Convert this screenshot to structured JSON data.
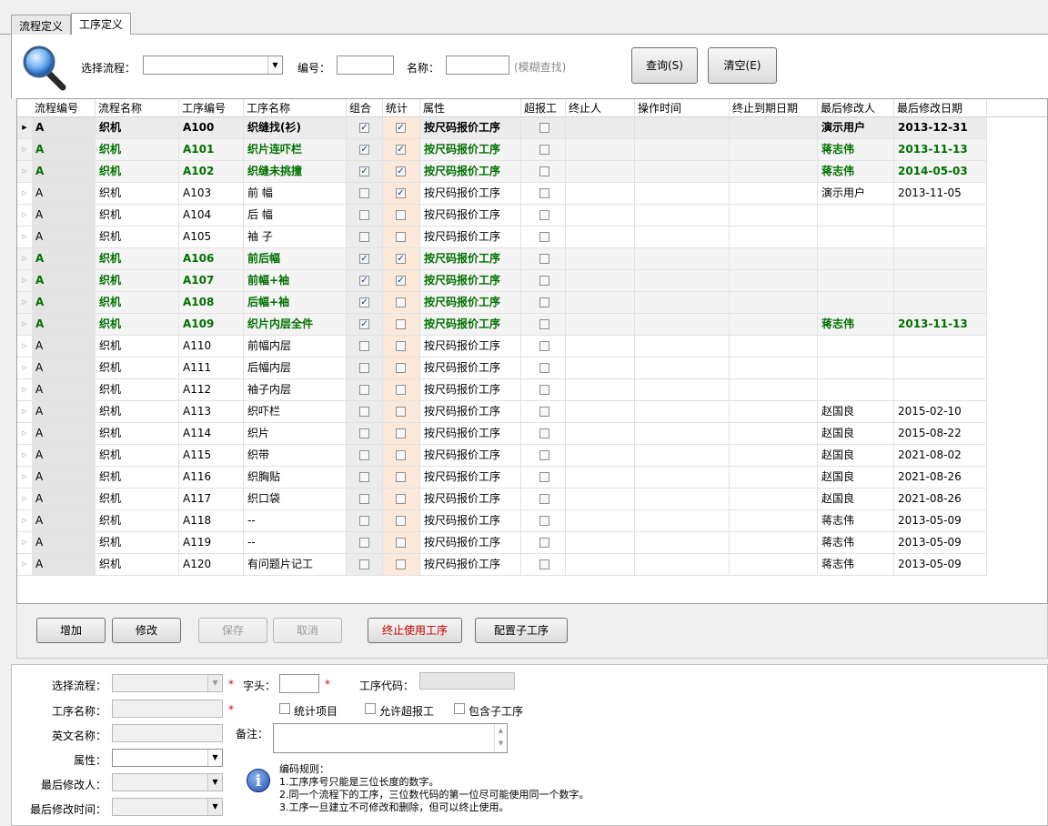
{
  "tabs": [
    {
      "label": "流程定义",
      "active": false
    },
    {
      "label": "工序定义",
      "active": true
    }
  ],
  "search": {
    "flow_label": "选择流程：",
    "code_label": "编号：",
    "name_label": "名称：",
    "fuzzy_hint": "(模糊查找)",
    "query_button": "查询(S)",
    "clear_button": "清空(E)"
  },
  "grid": {
    "columns": [
      "流程编号",
      "流程名称",
      "工序编号",
      "工序名称",
      "组合",
      "统计",
      "属性",
      "超报工",
      "终止人",
      "操作时间",
      "终止到期日期",
      "最后修改人",
      "最后修改日期"
    ],
    "rows": [
      {
        "flow": "A",
        "flow_name": "织机",
        "code": "A100",
        "name": "织缝找(衫)",
        "combo": true,
        "stat": true,
        "attr": "按尺码报价工序",
        "over": false,
        "modifier": "演示用户",
        "date": "2013-12-31",
        "style": "bold"
      },
      {
        "flow": "A",
        "flow_name": "织机",
        "code": "A101",
        "name": "织片连吓栏",
        "combo": true,
        "stat": true,
        "attr": "按尺码报价工序",
        "over": false,
        "modifier": "蒋志伟",
        "date": "2013-11-13",
        "style": "green"
      },
      {
        "flow": "A",
        "flow_name": "织机",
        "code": "A102",
        "name": "织缝未挑撞",
        "combo": true,
        "stat": true,
        "attr": "按尺码报价工序",
        "over": false,
        "modifier": "蒋志伟",
        "date": "2014-05-03",
        "style": "green"
      },
      {
        "flow": "A",
        "flow_name": "织机",
        "code": "A103",
        "name": "前 幅",
        "combo": false,
        "stat": true,
        "attr": "按尺码报价工序",
        "over": false,
        "modifier": "演示用户",
        "date": "2013-11-05",
        "style": "normal"
      },
      {
        "flow": "A",
        "flow_name": "织机",
        "code": "A104",
        "name": "后 幅",
        "combo": false,
        "stat": false,
        "attr": "按尺码报价工序",
        "over": false,
        "modifier": "",
        "date": "",
        "style": "normal"
      },
      {
        "flow": "A",
        "flow_name": "织机",
        "code": "A105",
        "name": "袖 子",
        "combo": false,
        "stat": false,
        "attr": "按尺码报价工序",
        "over": false,
        "modifier": "",
        "date": "",
        "style": "normal"
      },
      {
        "flow": "A",
        "flow_name": "织机",
        "code": "A106",
        "name": "前后幅",
        "combo": true,
        "stat": true,
        "attr": "按尺码报价工序",
        "over": false,
        "modifier": "",
        "date": "",
        "style": "green"
      },
      {
        "flow": "A",
        "flow_name": "织机",
        "code": "A107",
        "name": "前幅+袖",
        "combo": true,
        "stat": true,
        "attr": "按尺码报价工序",
        "over": false,
        "modifier": "",
        "date": "",
        "style": "green"
      },
      {
        "flow": "A",
        "flow_name": "织机",
        "code": "A108",
        "name": "后幅+袖",
        "combo": true,
        "stat": false,
        "attr": "按尺码报价工序",
        "over": false,
        "modifier": "",
        "date": "",
        "style": "green"
      },
      {
        "flow": "A",
        "flow_name": "织机",
        "code": "A109",
        "name": "织片内层全件",
        "combo": true,
        "stat": false,
        "attr": "按尺码报价工序",
        "over": false,
        "modifier": "蒋志伟",
        "date": "2013-11-13",
        "style": "green"
      },
      {
        "flow": "A",
        "flow_name": "织机",
        "code": "A110",
        "name": "前幅内层",
        "combo": false,
        "stat": false,
        "attr": "按尺码报价工序",
        "over": false,
        "modifier": "",
        "date": "",
        "style": "normal"
      },
      {
        "flow": "A",
        "flow_name": "织机",
        "code": "A111",
        "name": "后幅内层",
        "combo": false,
        "stat": false,
        "attr": "按尺码报价工序",
        "over": false,
        "modifier": "",
        "date": "",
        "style": "normal"
      },
      {
        "flow": "A",
        "flow_name": "织机",
        "code": "A112",
        "name": "袖子内层",
        "combo": false,
        "stat": false,
        "attr": "按尺码报价工序",
        "over": false,
        "modifier": "",
        "date": "",
        "style": "normal"
      },
      {
        "flow": "A",
        "flow_name": "织机",
        "code": "A113",
        "name": "织吓栏",
        "combo": false,
        "stat": false,
        "attr": "按尺码报价工序",
        "over": false,
        "modifier": "赵国良",
        "date": "2015-02-10",
        "style": "normal"
      },
      {
        "flow": "A",
        "flow_name": "织机",
        "code": "A114",
        "name": "织片",
        "combo": false,
        "stat": false,
        "attr": "按尺码报价工序",
        "over": false,
        "modifier": "赵国良",
        "date": "2015-08-22",
        "style": "normal"
      },
      {
        "flow": "A",
        "flow_name": "织机",
        "code": "A115",
        "name": "织带",
        "combo": false,
        "stat": false,
        "attr": "按尺码报价工序",
        "over": false,
        "modifier": "赵国良",
        "date": "2021-08-02",
        "style": "normal"
      },
      {
        "flow": "A",
        "flow_name": "织机",
        "code": "A116",
        "name": "织胸贴",
        "combo": false,
        "stat": false,
        "attr": "按尺码报价工序",
        "over": false,
        "modifier": "赵国良",
        "date": "2021-08-26",
        "style": "normal"
      },
      {
        "flow": "A",
        "flow_name": "织机",
        "code": "A117",
        "name": "织口袋",
        "combo": false,
        "stat": false,
        "attr": "按尺码报价工序",
        "over": false,
        "modifier": "赵国良",
        "date": "2021-08-26",
        "style": "normal"
      },
      {
        "flow": "A",
        "flow_name": "织机",
        "code": "A118",
        "name": "--",
        "combo": false,
        "stat": false,
        "attr": "按尺码报价工序",
        "over": false,
        "modifier": "蒋志伟",
        "date": "2013-05-09",
        "style": "normal"
      },
      {
        "flow": "A",
        "flow_name": "织机",
        "code": "A119",
        "name": "--",
        "combo": false,
        "stat": false,
        "attr": "按尺码报价工序",
        "over": false,
        "modifier": "蒋志伟",
        "date": "2013-05-09",
        "style": "normal"
      },
      {
        "flow": "A",
        "flow_name": "织机",
        "code": "A120",
        "name": "有问题片记工",
        "combo": false,
        "stat": false,
        "attr": "按尺码报价工序",
        "over": false,
        "modifier": "蒋志伟",
        "date": "2013-05-09",
        "style": "normal"
      }
    ]
  },
  "actions": {
    "add": "增加",
    "edit": "修改",
    "save": "保存",
    "cancel": "取消",
    "terminate": "终止使用工序",
    "config_sub": "配置子工序"
  },
  "edit": {
    "flow_label": "选择流程：",
    "prefix_label": "字头：",
    "code_label": "工序代码：",
    "name_label": "工序名称：",
    "stat_item": "统计项目",
    "allow_over": "允许超报工",
    "include_sub": "包含子工序",
    "english_label": "英文名称：",
    "remark_label": "备注：",
    "attr_label": "属性：",
    "modifier_label": "最后修改人：",
    "modtime_label": "最后修改时间：",
    "star": "*",
    "rules_title": "编码规则：",
    "rule1": "1.工序序号只能是三位长度的数字。",
    "rule2": "2.同一个流程下的工序，三位数代码的第一位尽可能使用同一个数字。",
    "rule3": "3.工序一旦建立不可修改和删除，但可以终止使用。"
  },
  "colors": {
    "green_text": "#007000",
    "terminate_text": "#c00000",
    "stat_col_bg": "#fde9d9",
    "combo_col_bg": "#ececec",
    "required_star": "#e00000"
  }
}
